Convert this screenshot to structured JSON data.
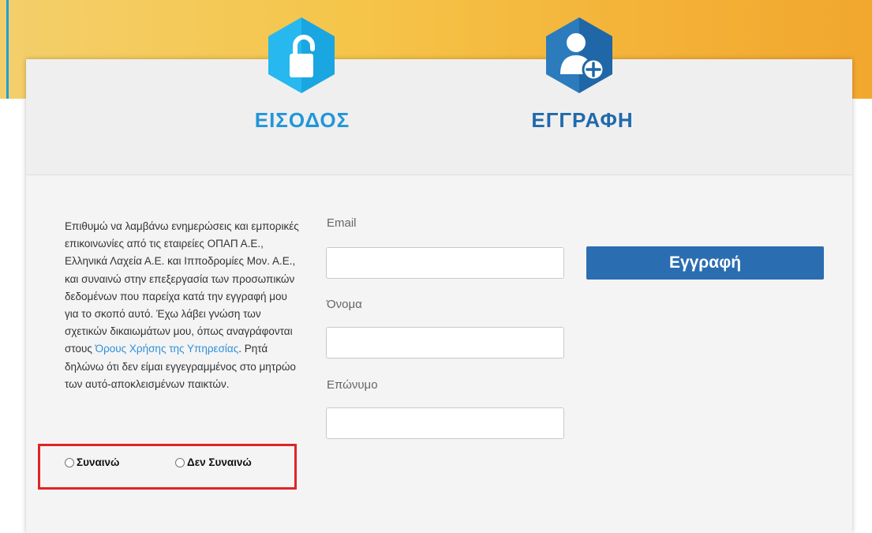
{
  "tabs": {
    "login": {
      "label": "ΕΙΣΟΔΟΣ",
      "icon": "unlocked-padlock-icon",
      "color": "#27b8ef"
    },
    "register": {
      "label": "ΕΓΓΡΑΦΗ",
      "icon": "add-user-icon",
      "color": "#2b7bbd"
    }
  },
  "consent": {
    "text_before_link": "Επιθυμώ να λαμβάνω ενημερώσεις και εμπορικές επικοινωνίες από τις εταιρείες ΟΠΑΠ Α.Ε., Ελληνικά Λαχεία Α.Ε. και Ιπποδρομίες Μον. Α.Ε., και συναινώ στην επεξεργασία των προσωπικών δεδομένων που παρείχα κατά την εγγραφή μου για το σκοπό αυτό. Έχω λάβει γνώση των σχετικών δικαιωμάτων μου, όπως αναγράφονται στους ",
    "link_text": "Όρους Χρήσης της Υπηρεσίας",
    "text_after_link": ". Ρητά δηλώνω ότι δεν είμαι εγγεγραμμένος στο μητρώο των αυτό-αποκλεισμένων παικτών.",
    "agree_label": "Συναινώ",
    "disagree_label": "Δεν Συναινώ",
    "highlight_color": "#e02424"
  },
  "form": {
    "email_label": "Email",
    "email_value": "",
    "first_name_label": "Όνομα",
    "first_name_value": "",
    "last_name_label": "Επώνυμο",
    "last_name_value": "",
    "submit_label": "Εγγραφή",
    "submit_color": "#2b6db1"
  },
  "colors": {
    "banner": "#f5c54a",
    "link": "#2f8fd8"
  }
}
